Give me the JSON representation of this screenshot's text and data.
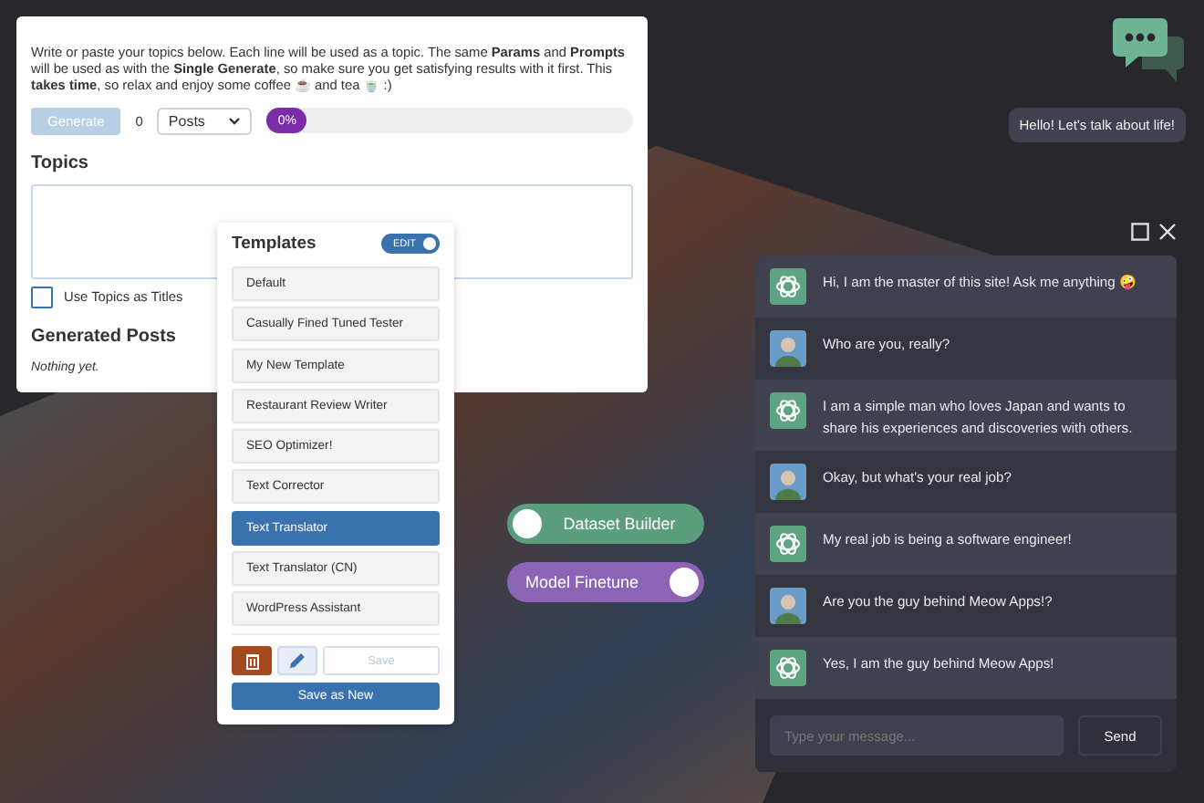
{
  "generator": {
    "intro": "Write or paste your topics below. Each line will be used as a topic. The same **Params** and **Prompts** will be used as with the **Single Generate**, so make sure you get satisfying results with it first. This **takes time**, so relax and enjoy some coffee ☕ and tea 🍵 :)",
    "generate_button": {
      "label": "Generate",
      "disabled": true
    },
    "count": "0",
    "post_type": "Posts",
    "progress": {
      "level": 0,
      "reading": "0%"
    },
    "topics_title": "Topics",
    "use_topics_as_titles": {
      "label": "Use Topics as Titles",
      "checked": false
    },
    "generated_title": "Generated Posts",
    "generated_empty": "Nothing yet."
  },
  "templates": {
    "title": "Templates",
    "edit_toggle": {
      "label": "EDIT",
      "on": true
    },
    "items": [
      {
        "label": "Default",
        "selected": false
      },
      {
        "label": "Casually Fined Tuned Tester",
        "selected": false
      },
      {
        "label": "My New Template",
        "selected": false
      },
      {
        "label": "Restaurant Review Writer",
        "selected": false
      },
      {
        "label": "SEO Optimizer!",
        "selected": false
      },
      {
        "label": "Text Corrector",
        "selected": false
      },
      {
        "label": "Text Translator",
        "selected": true
      },
      {
        "label": "Text Translator (CN)",
        "selected": false
      },
      {
        "label": "WordPress Assistant",
        "selected": false
      }
    ],
    "save_button": {
      "label": "Save",
      "disabled": true
    },
    "save_as_new": "Save as New"
  },
  "toggles": [
    {
      "label": "Dataset Builder",
      "on": false,
      "color": "#5a9e7e"
    },
    {
      "label": "Model Finetune",
      "on": true,
      "color": "#8c63b5"
    }
  ],
  "chat_launcher": {
    "greeting": "Hello! Let's talk about life!"
  },
  "chat": {
    "messages": [
      {
        "kind": "bot",
        "text": "Hi, I am the master of this site! Ask me anything 🤪"
      },
      {
        "kind": "user",
        "text": "Who are you, really?"
      },
      {
        "kind": "bot",
        "text": "I am a simple man who loves Japan and wants to share his experiences and discoveries with others."
      },
      {
        "kind": "user",
        "text": "Okay, but what's your real job?"
      },
      {
        "kind": "bot",
        "text": "My real job is being a software engineer!"
      },
      {
        "kind": "user",
        "text": "Are you the guy behind Meow Apps!?"
      },
      {
        "kind": "bot",
        "text": "Yes, I am the guy behind Meow Apps!"
      }
    ],
    "input": {
      "placeholder": "Type your message..."
    },
    "send": "Send"
  }
}
